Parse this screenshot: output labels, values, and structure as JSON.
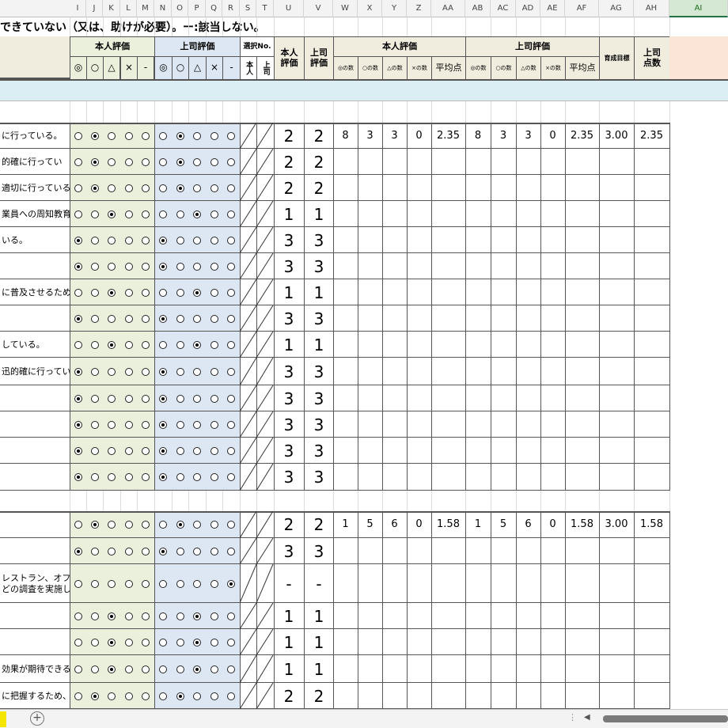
{
  "columns": [
    "I",
    "J",
    "K",
    "L",
    "M",
    "N",
    "O",
    "P",
    "Q",
    "R",
    "S",
    "T",
    "U",
    "V",
    "W",
    "X",
    "Y",
    "Z",
    "AA",
    "AB",
    "AC",
    "AD",
    "AE",
    "AF",
    "AG",
    "AH",
    "AI"
  ],
  "selected_column": "AI",
  "title": "できていない（又は、助けが必要）。ー:該当しない。",
  "header": {
    "self_eval": "本人評価",
    "boss_eval": "上司評価",
    "symbols": [
      "◎",
      "○",
      "△",
      "×",
      "-"
    ],
    "select_no": "選択No.",
    "select_self": "本人",
    "select_boss": "上司",
    "self_score": "本人評価",
    "boss_score": "上司評価",
    "self_eval_summary": "本人評価",
    "boss_eval_summary": "上司評価",
    "count_labels": [
      "◎の数",
      "○の数",
      "△の数",
      "×の数"
    ],
    "average": "平均点",
    "target": "育成目標",
    "boss_points": "上司点数"
  },
  "rows": [
    {
      "text": "に行っている。",
      "self": 1,
      "boss": 1,
      "s": "2",
      "b": "2"
    },
    {
      "text": "的確に行ってい",
      "self": 1,
      "boss": 1,
      "s": "2",
      "b": "2"
    },
    {
      "text": "適切に行っている。",
      "self": 1,
      "boss": 1,
      "s": "2",
      "b": "2"
    },
    {
      "text": "業員への周知教育",
      "self": 2,
      "boss": 2,
      "s": "1",
      "b": "1"
    },
    {
      "text": "いる。",
      "self": 0,
      "boss": 0,
      "s": "3",
      "b": "3"
    },
    {
      "text": "",
      "self": 0,
      "boss": 0,
      "s": "3",
      "b": "3"
    },
    {
      "text": "に普及させるため",
      "self": 2,
      "boss": 2,
      "s": "1",
      "b": "1"
    },
    {
      "text": "",
      "self": 0,
      "boss": 0,
      "s": "3",
      "b": "3"
    },
    {
      "text": "している。",
      "self": 2,
      "boss": 2,
      "s": "1",
      "b": "1"
    },
    {
      "text": "迅的確に行ってい",
      "self": 0,
      "boss": 0,
      "s": "3",
      "b": "3"
    },
    {
      "text": "",
      "self": 0,
      "boss": 0,
      "s": "3",
      "b": "3"
    },
    {
      "text": "",
      "self": 0,
      "boss": 0,
      "s": "3",
      "b": "3"
    },
    {
      "text": "",
      "self": 0,
      "boss": 0,
      "s": "3",
      "b": "3"
    },
    {
      "text": "",
      "self": 0,
      "boss": 0,
      "s": "3",
      "b": "3"
    },
    {
      "text": "",
      "self": 1,
      "boss": 1,
      "s": "2",
      "b": "2"
    },
    {
      "text": "",
      "self": 0,
      "boss": 0,
      "s": "3",
      "b": "3"
    },
    {
      "text": "レストラン、オフィ\nどの調査を実施し",
      "self": -1,
      "boss": 4,
      "s": "-",
      "b": "-"
    },
    {
      "text": "",
      "self": 2,
      "boss": 2,
      "s": "1",
      "b": "1"
    },
    {
      "text": "",
      "self": 2,
      "boss": 2,
      "s": "1",
      "b": "1"
    },
    {
      "text": "効果が期待できる",
      "self": 2,
      "boss": 2,
      "s": "1",
      "b": "1"
    },
    {
      "text": "に把握するため、",
      "self": 1,
      "boss": 1,
      "s": "2",
      "b": "2"
    }
  ],
  "summaries": [
    {
      "self_counts": [
        "8",
        "3",
        "3",
        "0"
      ],
      "self_avg": "2.35",
      "boss_counts": [
        "8",
        "3",
        "3",
        "0"
      ],
      "boss_avg": "2.35",
      "target": "3.00",
      "boss_points": "2.35"
    },
    {
      "self_counts": [
        "1",
        "5",
        "6",
        "0"
      ],
      "self_avg": "1.58",
      "boss_counts": [
        "1",
        "5",
        "6",
        "0"
      ],
      "boss_avg": "1.58",
      "target": "3.00",
      "boss_points": "1.58"
    }
  ],
  "colors": {
    "self_bg": "#eaf0dc",
    "boss_bg": "#dde7f3",
    "header_bg": "#f0ecde",
    "band_bg": "#daeef3",
    "selected_header": "#fbe5d6",
    "sheet_tab": "#f5e600"
  },
  "icons": [
    "add-sheet-icon",
    "scroll-left-icon"
  ]
}
